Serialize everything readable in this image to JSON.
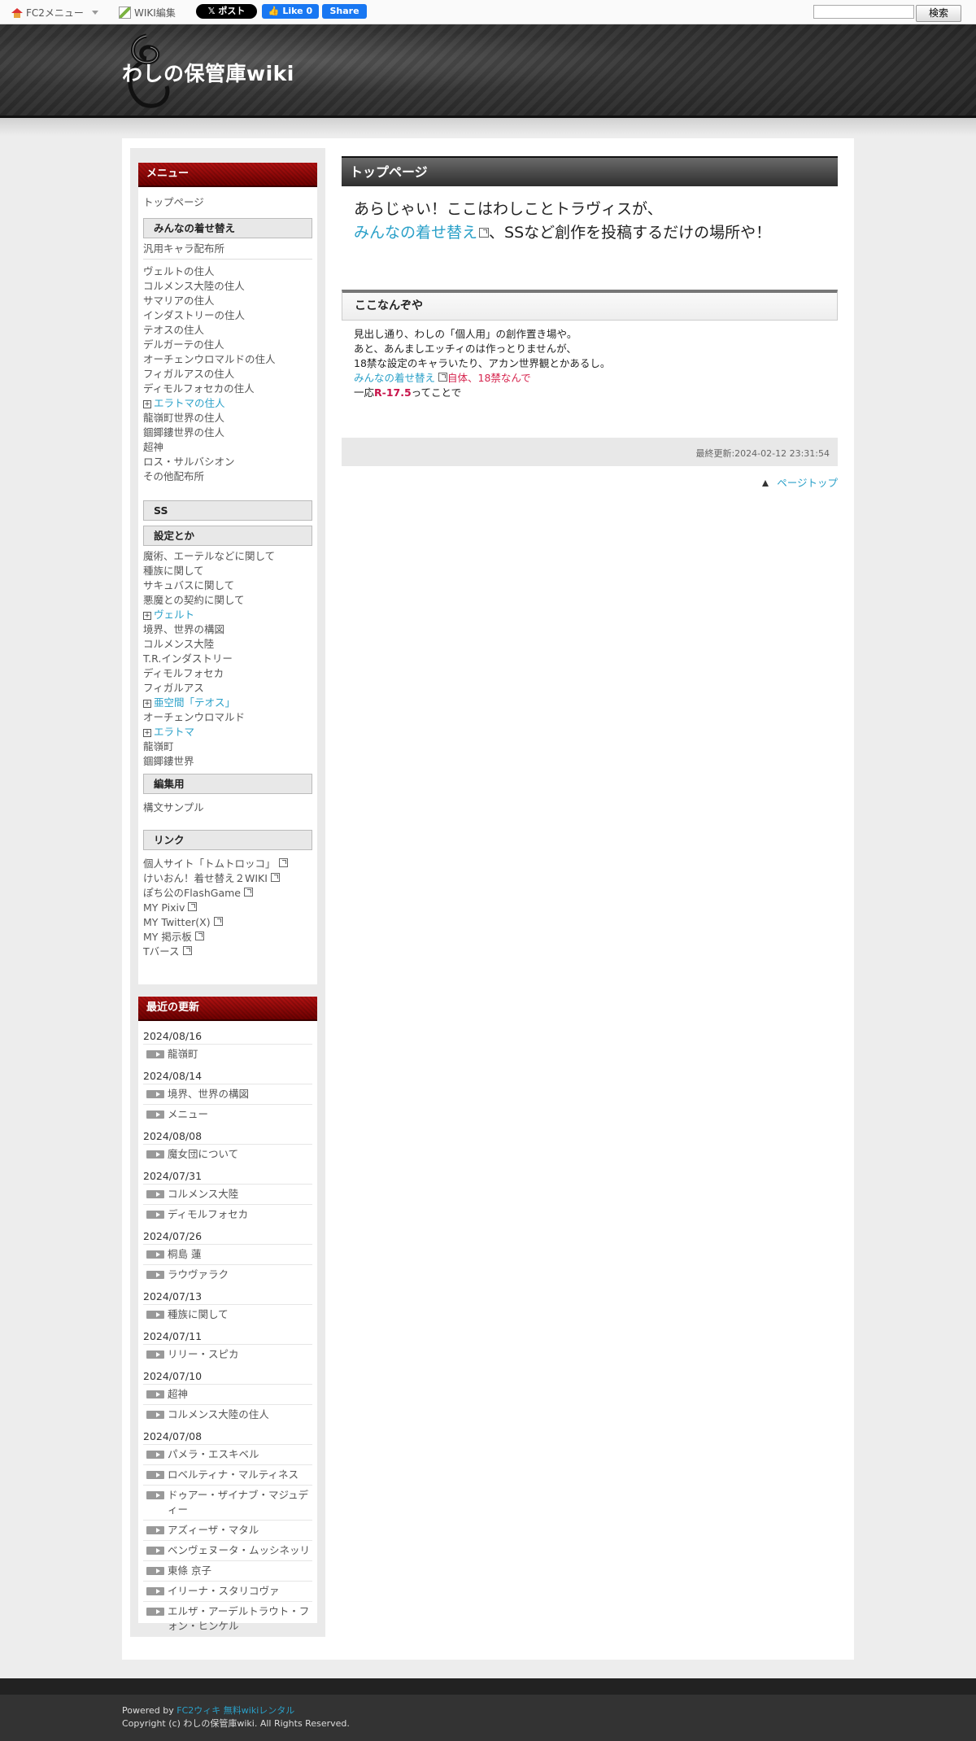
{
  "topbar": {
    "fc2_menu": "FC2メニュー",
    "wiki_edit": "WIKI編集",
    "x_post": "𝕏 ポスト",
    "fb_like": "👍 Like 0",
    "fb_share": "Share",
    "search_button": "検索",
    "search_value": ""
  },
  "header": {
    "title": "わしの保管庫wiki"
  },
  "menu": {
    "heading": "メニュー",
    "top": "トップページ",
    "sections": [
      {
        "title": "みんなの着せ替え",
        "items": [
          {
            "label": "汎用キャラ配布所"
          },
          {
            "label": "ヴェルトの住人"
          },
          {
            "label": "コルメンス大陸の住人"
          },
          {
            "label": "サマリアの住人"
          },
          {
            "label": "インダストリーの住人"
          },
          {
            "label": "テオスの住人"
          },
          {
            "label": "デルガーテの住人"
          },
          {
            "label": "オーチェンウロマルドの住人"
          },
          {
            "label": "フィガルアスの住人"
          },
          {
            "label": "ディモルフォセカの住人"
          },
          {
            "label": "エラトマの住人"
          },
          {
            "label": "龍嶺町世界の住人"
          },
          {
            "label": "錮鎁鏤世界の住人"
          },
          {
            "label": "超神"
          },
          {
            "label": "ロス・サルバシオン"
          },
          {
            "label": "その他配布所"
          }
        ]
      },
      {
        "title": "SS",
        "items": []
      },
      {
        "title": "設定とか",
        "items": [
          {
            "label": "魔術、エーテルなどに関して"
          },
          {
            "label": "種族に関して"
          },
          {
            "label": "サキュバスに関して"
          },
          {
            "label": "悪魔との契約に関して"
          },
          {
            "label": "ヴェルト"
          },
          {
            "label": "境界、世界の構図"
          },
          {
            "label": "コルメンス大陸"
          },
          {
            "label": "T.R.インダストリー"
          },
          {
            "label": "ディモルフォセカ"
          },
          {
            "label": "フィガルアス"
          },
          {
            "label": "亜空間「テオス」"
          },
          {
            "label": "オーチェンウロマルド"
          },
          {
            "label": "エラトマ"
          },
          {
            "label": "龍嶺町"
          },
          {
            "label": "錮鎁鏤世界"
          }
        ]
      },
      {
        "title": "編集用",
        "items": [
          {
            "label": "構文サンプル"
          }
        ]
      },
      {
        "title": "リンク",
        "items": [
          {
            "label": "個人サイト「トムトロッコ」"
          },
          {
            "label": "けいおん！着せ替え２WIKI"
          },
          {
            "label": "ぽち公のFlashGame"
          },
          {
            "label": "MY Pixiv"
          },
          {
            "label": "MY Twitter(X)"
          },
          {
            "label": "MY 掲示板"
          },
          {
            "label": "Tバース"
          }
        ]
      }
    ]
  },
  "recent": {
    "heading": "最近の更新",
    "groups": [
      {
        "date": "2024/08/16",
        "items": [
          "龍嶺町"
        ]
      },
      {
        "date": "2024/08/14",
        "items": [
          "境界、世界の構図",
          "メニュー"
        ]
      },
      {
        "date": "2024/08/08",
        "items": [
          "魔女団について"
        ]
      },
      {
        "date": "2024/07/31",
        "items": [
          "コルメンス大陸",
          "ディモルフォセカ"
        ]
      },
      {
        "date": "2024/07/26",
        "items": [
          "桐島 蓮",
          "ラウヴァラク"
        ]
      },
      {
        "date": "2024/07/13",
        "items": [
          "種族に関して"
        ]
      },
      {
        "date": "2024/07/11",
        "items": [
          "リリー・スピカ"
        ]
      },
      {
        "date": "2024/07/10",
        "items": [
          "超神",
          "コルメンス大陸の住人"
        ]
      },
      {
        "date": "2024/07/08",
        "items": [
          "パメラ・エスキベル",
          "ロベルティナ・マルティネス",
          "ドゥアー・ザイナブ・マジュディー",
          "アズィーザ・マタル",
          "ベンヴェヌータ・ムッシネッリ",
          "東條 京子",
          "イリーナ・スタリコヴァ",
          "エルザ・アーデルトラウト・フォン・ヒンケル"
        ]
      }
    ]
  },
  "main": {
    "page_title": "トップページ",
    "intro_line1": "あらじゃい！ここはわしことトラヴィスが、",
    "intro_link": "みんなの着せ替え",
    "intro_line2_rest": "、SSなど創作を投稿するだけの場所や！",
    "section_title": "ここなんぞや",
    "body_line1": "見出し通り、わしの「個人用」の創作置き場や。",
    "body_line2": "あと、あんましエッチィのは作っとりませんが、",
    "body_line3": "18禁な設定のキャラいたり、アカン世界観とかあるし。",
    "body_link": "みんなの着せ替え",
    "body_red": "自体、18禁なんで",
    "body_line5_pre": "一応",
    "body_line5_bold": "R-17.5",
    "body_line5_post": "ってことで",
    "last_modified": "最終更新:2024-02-12 23:31:54",
    "page_top": "ページトップ"
  },
  "footer": {
    "powered_by": "Powered by ",
    "powered_link": "FC2ウィキ 無料wikiレンタル",
    "copyright": "Copyright (c) わしの保管庫wiki. All Rights Reserved."
  }
}
